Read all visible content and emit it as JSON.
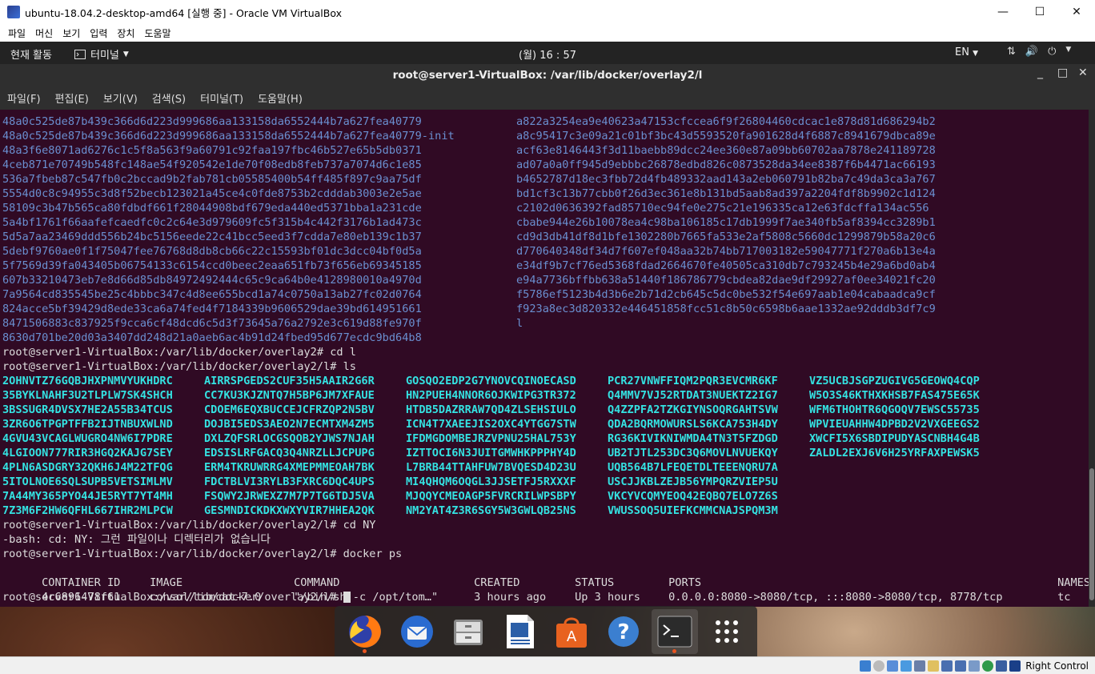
{
  "window": {
    "title": "ubuntu-18.04.2-desktop-amd64 [실행 중] - Oracle VM VirtualBox",
    "minimize": "—",
    "maximize": "☐",
    "close": "✕"
  },
  "vb_menu": [
    "파일",
    "머신",
    "보기",
    "입력",
    "장치",
    "도움말"
  ],
  "topbar": {
    "activities": "현재 활동",
    "app_menu": "터미널",
    "clock": "(월) 16 : 57",
    "input_lang": "EN"
  },
  "terminal": {
    "title": "root@server1-VirtualBox: /var/lib/docker/overlay2/l",
    "menu": [
      "파일(F)",
      "편집(E)",
      "보기(V)",
      "검색(S)",
      "터미널(T)",
      "도움말(H)"
    ],
    "overlay_dirs": [
      [
        "48a0c525de87b439c366d6d223d999686aa133158da6552444b7a627fea40779",
        "a822a3254ea9e40623a47153cfccea6f9f26804460cdcac1e878d81d686294b2"
      ],
      [
        "48a0c525de87b439c366d6d223d999686aa133158da6552444b7a627fea40779-init",
        "a8c95417c3e09a21c01bf3bc43d5593520fa901628d4f6887c8941679dbca89e"
      ],
      [
        "48a3f6e8071ad6276c1c5f8a563f9a60791c92faa197fbc46b527e65b5db0371",
        "acf63e8146443f3d11baebb89dcc24ee360e87a09bb60702aa7878e241189728"
      ],
      [
        "4ceb871e70749b548fc148ae54f920542e1de70f08edb8feb737a7074d6c1e85",
        "ad07a0a0ff945d9ebbbc26878edbd826c0873528da34ee8387f6b4471ac66193"
      ],
      [
        "536a7fbeb87c547fb0c2bccad9b2fab781cb05585400b54ff485f897c9aa75df",
        "b4652787d18ec3fbb72d4fb489332aad143a2eb060791b82ba7c49da3ca3a767"
      ],
      [
        "5554d0c8c94955c3d8f52becb123021a45ce4c0fde8753b2cdddab3003e2e5ae",
        "bd1cf3c13b77cbb0f26d3ec361e8b131bd5aab8ad397a2204fdf8b9902c1d124"
      ],
      [
        "58109c3b47b565ca80fdbdf661f28044908bdf679eda440ed5371bba1a231cde",
        "c2102d0636392fad85710ec94fe0e275c21e196335ca12e63fdcffa134ac556"
      ],
      [
        "5a4bf1761f66aafefcaedfc0c2c64e3d979609fc5f315b4c442f3176b1ad473c",
        "cbabe944e26b10078ea4c98ba106185c17db1999f7ae340fb5af8394cc3289b1"
      ],
      [
        "5d5a7aa23469ddd556b24bc5156eede22c41bcc5eed3f7cdda7e80eb139c1b37",
        "cd9d3db41df8d1bfe1302280b7665fa533e2af5808c5660dc1299879b58a20c6"
      ],
      [
        "5debf9760ae0f1f75047fee76768d8db8cb66c22c15593bf01dc3dcc04bf0d5a",
        "d770640348df34d7f607ef048aa32b74bb717003182e59047771f270a6b13e4a"
      ],
      [
        "5f7569d39fa043405b06754133c6154ccd0beec2eaa651fb73f656eb69345185",
        "e34df9b7cf76ed5368fdad2664670fe40505ca310db7c793245b4e29a6bd0ab4"
      ],
      [
        "607b33210473eb7e8d66d85db84972492444c65c9ca64b0e4128980010a4970d",
        "e94a7736bffbb638a51440f186786779cbdea82dae9df29927af0ee34021fc20"
      ],
      [
        "7a9564cd835545be25c4bbbc347c4d8ee655bcd1a74c0750a13ab27fc02d0764",
        "f5786ef5123b4d3b6e2b71d2cb645c5dc0be532f54e697aab1e04cabaadca9cf"
      ],
      [
        "824acce5bf39429d8ede33ca6a74fed4f7184339b9606529dae39bd614951661",
        "f923a8ec3d820332e446451858fcc51c8b50c6598b6aae1332ae92dddb3df7c9"
      ],
      [
        "8471506883c837925f9cca6cf48dcd6c5d3f73645a76a2792e3c619d88fe970f",
        "l"
      ],
      [
        "8630d701be20d03a3407dd248d21a0aeb6ac4b91d24fbed95d677ecdc9bd64b8",
        ""
      ]
    ],
    "prompt_cd_l": "root@server1-VirtualBox:/var/lib/docker/overlay2# cd l",
    "prompt_ls": "root@server1-VirtualBox:/var/lib/docker/overlay2/l# ls",
    "ls_rows": [
      [
        "2OHNVTZ76GQBJHXPNMVYUKHDRC",
        "AIRRSPGEDS2CUF35H5AAIR2G6R",
        "GOSQO2EDP2G7YNOVCQINOECASD",
        "PCR27VNWFFIQM2PQR3EVCMR6KF",
        "VZ5UCBJSGPZUGIVG5GEOWQ4CQP"
      ],
      [
        "35BYKLNAHF3U2TLPLW7SK4SHCH",
        "CC7KU3KJZNTQ7H5BP6JM7XFAUE",
        "HN2PUEH4NNOR6OJKWIPG3TR372",
        "Q4MMV7VJ52RTDAT3NUEKTZ2IG7",
        "W5O3S46KTHXKHSB7FAS475E65K"
      ],
      [
        "3BSSUGR4DVSX7HE2A55B34TCUS",
        "CDOEM6EQXBUCCEJCFRZQP2N5BV",
        "HTDB5DAZRRAW7QD4ZLSEHSIULO",
        "Q4ZZPFA2TZKGIYNSOQRGAHTSVW",
        "WFM6THOHTR6QGOQV7EWSC55735"
      ],
      [
        "3ZR6O6TPGPTFFB2IJTNBUXWLND",
        "DOJBI5EDS3AEO2N7ECMTXM4ZM5",
        "ICN4T7XAEEJIS2OXC4YTGG7STW",
        "QDA2BQRMOWURSLS6KCA753H4DY",
        "WPVIEUAHHW4DPBD2V2VXGEEGS2"
      ],
      [
        "4GVU43VCAGLWUGRO4NW6I7PDRE",
        "DXLZQFSRLOCGSQOB2YJWS7NJAH",
        "IFDMGDOMBEJRZVPNU25HAL753Y",
        "RG36KIVIKNIWMDA4TN3T5FZDGD",
        "XWCFI5X6SBDIPUDYASCNBH4G4B"
      ],
      [
        "4LGIOON777RIR3HGQ2KAJG7SEY",
        "EDSISLRFGACQ3Q4NRZLLJCPUPG",
        "IZTTOCI6N3JUITGMWHKPPPHY4D",
        "UB2TJTL253DC3Q6MOVLNVUEKQY",
        "ZALDL2EXJ6V6H25YRFAXPEWSK5"
      ],
      [
        "4PLN6ASDGRY32QKH6J4M22TFQG",
        "ERM4TKRUWRRG4XMEPMMEOAH7BK",
        "L7BRB44TTAHFUW7BVQESD4D23U",
        "UQB564B7LFEQETDLTEEENQRU7A",
        ""
      ],
      [
        "5ITOLNOE6SQLSUPB5VETSIMLMV",
        "FDCTBLVI3RYLB3FXRC6DQC4UPS",
        "MI4QHQM6OQGL3JJSETFJ5RXXXF",
        "USCJJKBLZEJB56YMPQRZVIEP5U",
        ""
      ],
      [
        "7A44MY365PYO44JE5RYT7YT4MH",
        "FSQWY2JRWEXZ7M7P7TG6TDJ5VA",
        "MJQQYCMEOAGP5FVRCRILWPSBPY",
        "VKCYVCQMYEOQ42EQBQ7ELO7Z6S",
        ""
      ],
      [
        "7Z3M6F2HW6QFHL667IHR2MLPCW",
        "GESMNDICKDKXWXYVIR7HHEA2QK",
        "NM2YAT4Z3R6SGY5W3GWLQB25NS",
        "VWUSSOQ5UIEFKCMMCNAJSPQM3M",
        ""
      ]
    ],
    "prompt_cd_ny": "root@server1-VirtualBox:/var/lib/docker/overlay2/l# cd NY",
    "error_line": "-bash: cd: NY: 그런 파일이나 디렉터리가 없습니다",
    "prompt_docker": "root@server1-VirtualBox:/var/lib/docker/overlay2/l# docker ps",
    "docker_headers": [
      "CONTAINER ID",
      "IMAGE",
      "COMMAND",
      "CREATED",
      "STATUS",
      "PORTS",
      "NAMES"
    ],
    "docker_row": [
      "4c6896478f61",
      "consol/tomcat-7.0",
      "\"/bin/sh -c /opt/tom…\"",
      "3 hours ago",
      "Up 3 hours",
      "0.0.0.0:8080->8080/tcp, :::8080->8080/tcp, 8778/tcp",
      "tc"
    ],
    "prompt_final": "root@server1-VirtualBox:/var/lib/docker/overlay2/l# "
  },
  "dock_items": [
    "firefox-icon",
    "thunderbird-icon",
    "files-icon",
    "libreoffice-writer-icon",
    "software-center-icon",
    "help-icon",
    "terminal-icon",
    "show-apps-icon"
  ],
  "status": {
    "host_key": "Right Control"
  },
  "colors": {
    "terminal_bg": "#300a24",
    "dir_blue": "#6a8fd0",
    "ls_cyan": "#34e2e2",
    "ubuntu_orange": "#e95420"
  }
}
